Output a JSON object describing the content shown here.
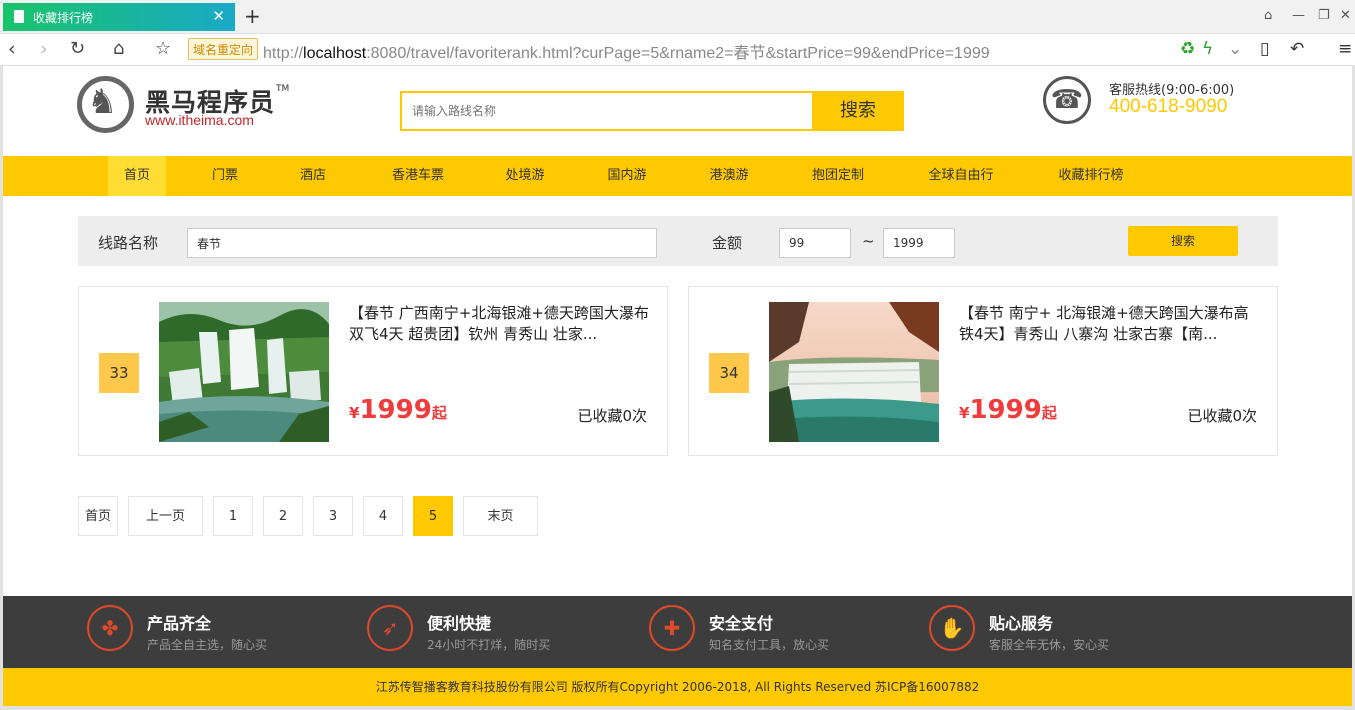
{
  "browser": {
    "tab_title": "收藏排行榜",
    "tab_close": "✕",
    "new_tab": "+",
    "redirect_tag": "域名重定向",
    "url_prefix": "http://",
    "url_host": "localhost",
    "url_rest": ":8080/travel/favoriterank.html?curPage=5&rname2=春节&startPrice=99&endPrice=1999"
  },
  "header": {
    "logo_cn": "黑马程序员",
    "logo_tm": "TM",
    "logo_en": "www.itheima.com",
    "search_placeholder": "请输入路线名称",
    "search_button": "搜索",
    "hotline_label": "客服热线(9:00-6:00)",
    "hotline_number": "400-618-9090"
  },
  "nav": {
    "items": [
      {
        "label": "首页"
      },
      {
        "label": "门票"
      },
      {
        "label": "酒店"
      },
      {
        "label": "香港车票"
      },
      {
        "label": "处境游"
      },
      {
        "label": "国内游"
      },
      {
        "label": "港澳游"
      },
      {
        "label": "抱团定制"
      },
      {
        "label": "全球自由行"
      },
      {
        "label": "收藏排行榜"
      }
    ],
    "active_index": 0
  },
  "filter": {
    "route_label": "线路名称",
    "route_value": "春节",
    "amount_label": "金额",
    "min_price": "99",
    "tilde": "~",
    "max_price": "1999",
    "search_button": "搜索"
  },
  "cards": [
    {
      "rank": "33",
      "title": "【春节 广西南宁+北海银滩+德天跨国大瀑布双飞4天 超贵团】钦州 青秀山 壮家...",
      "currency": "¥",
      "price": "1999",
      "suffix": "起",
      "favorites": "已收藏0次"
    },
    {
      "rank": "34",
      "title": "【春节 南宁+ 北海银滩+德天跨国大瀑布高铁4天】青秀山 八寨沟 壮家古寨【南...",
      "currency": "¥",
      "price": "1999",
      "suffix": "起",
      "favorites": "已收藏0次"
    }
  ],
  "pagination": {
    "first": "首页",
    "prev": "上一页",
    "pages": [
      "1",
      "2",
      "3",
      "4",
      "5"
    ],
    "current": "5",
    "last": "末页"
  },
  "footer": {
    "features": [
      {
        "title": "产品齐全",
        "subtitle": "产品全自主选，随心买",
        "icon": "clover-icon"
      },
      {
        "title": "便利快捷",
        "subtitle": "24小时不打烊，随时买",
        "icon": "rocket-icon"
      },
      {
        "title": "安全支付",
        "subtitle": "知名支付工具，放心买",
        "icon": "shield-icon"
      },
      {
        "title": "贴心服务",
        "subtitle": "客服全年无休，安心买",
        "icon": "thumbs-up-icon"
      }
    ],
    "copyright": "江苏传智播客教育科技股份有限公司 版权所有Copyright 2006-2018, All Rights Reserved 苏ICP备16007882"
  },
  "colors": {
    "brand_yellow": "#ffc900",
    "price_red": "#ef3b3b",
    "footer_dark": "#3d3d3d",
    "footer_icon": "#e04a2b"
  }
}
